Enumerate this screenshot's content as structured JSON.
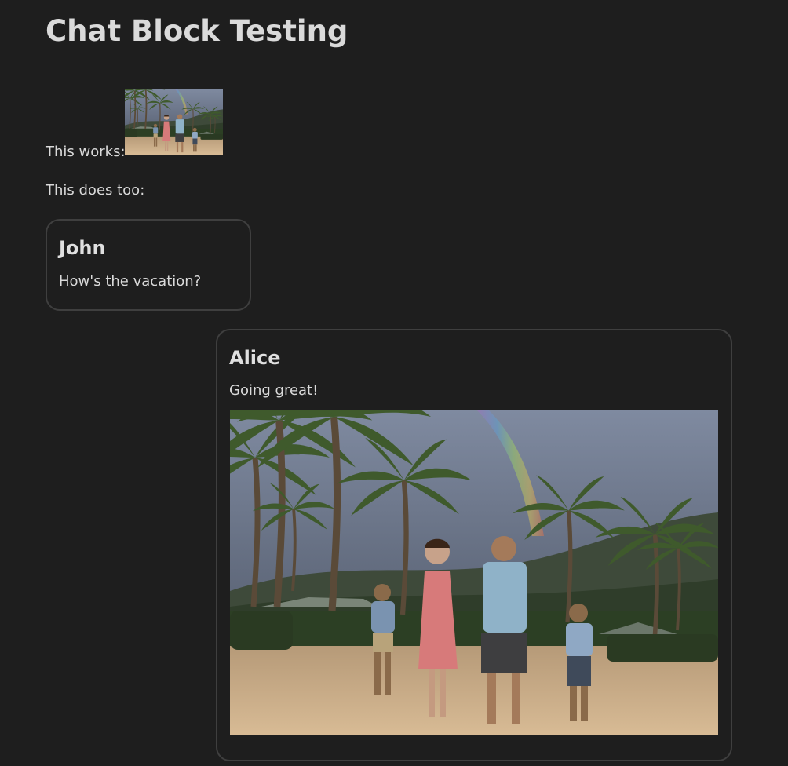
{
  "page": {
    "title": "Chat Block Testing"
  },
  "inline_image_line": {
    "label": "This works:"
  },
  "second_line": {
    "text": "This does too:"
  },
  "chat": [
    {
      "name": "John",
      "message": "How's the vacation?"
    },
    {
      "name": "Alice",
      "message": "Going great!"
    }
  ],
  "colors": {
    "background": "#1e1e1e",
    "text": "#dadada",
    "bubble_border": "#3f3f3f"
  }
}
